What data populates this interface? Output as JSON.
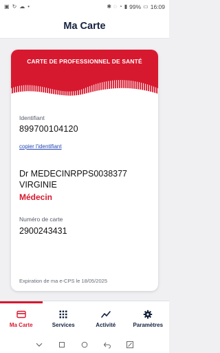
{
  "status_bar": {
    "battery_percent": "99%",
    "time": "16:09"
  },
  "header": {
    "title": "Ma Carte"
  },
  "card": {
    "band_title": "CARTE DE PROFESSIONNEL DE SANTÉ",
    "identifier_label": "Identifiant",
    "identifier_value": "899700104120",
    "copy_link": "copier l'identifiant",
    "name_line1": "Dr MEDECINRPPS0038377",
    "name_line2": "VIRGINIE",
    "profession": "Médecin",
    "card_number_label": "Numéro de carte",
    "card_number_value": "2900243431",
    "expiry_text": "Expiration de ma e-CPS le 18/05/2025"
  },
  "bottom_nav": {
    "items": [
      {
        "label": "Ma Carte",
        "icon": "card-icon",
        "active": true
      },
      {
        "label": "Services",
        "icon": "grid-icon",
        "active": false
      },
      {
        "label": "Activité",
        "icon": "activity-icon",
        "active": false
      },
      {
        "label": "Paramètres",
        "icon": "gear-icon",
        "active": false
      }
    ]
  },
  "colors": {
    "accent": "#d7192f",
    "navy": "#14213d",
    "link": "#2346b3"
  }
}
